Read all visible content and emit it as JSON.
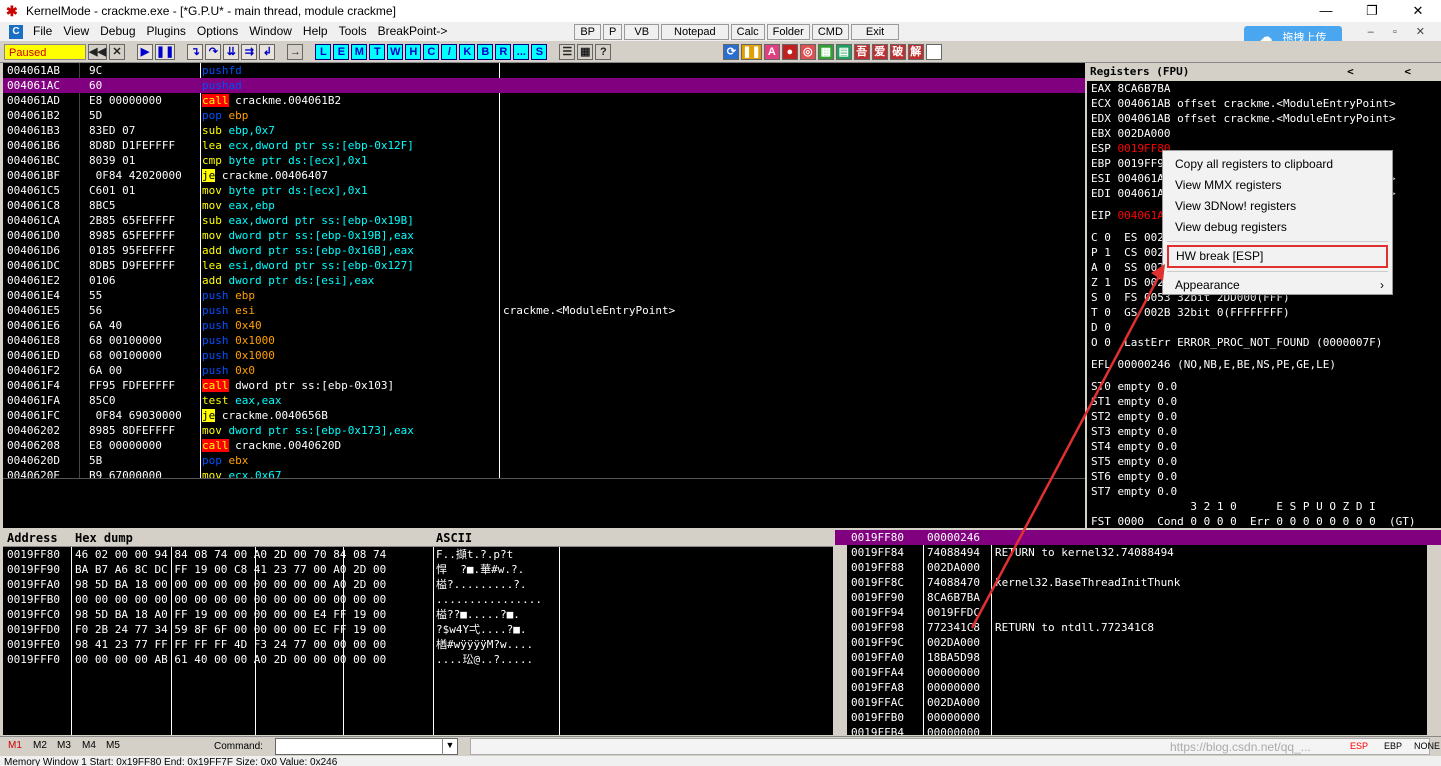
{
  "window": {
    "title": "KernelMode - crackme.exe - [*G.P.U* - main thread, module crackme]",
    "controls": [
      "—",
      "❐",
      "✕"
    ]
  },
  "menu": {
    "items": [
      "File",
      "View",
      "Debug",
      "Plugins",
      "Options",
      "Window",
      "Help",
      "Tools",
      "BreakPoint->"
    ],
    "tool_buttons": [
      "BP",
      "P",
      "VB",
      "Notepad",
      "Calc",
      "Folder",
      "CMD",
      "Exit"
    ],
    "mdi_controls": "– ▫ ✕"
  },
  "cloud_button": {
    "label": "拖拽上传"
  },
  "toolbar": {
    "status": "Paused",
    "letter_buttons": [
      "L",
      "E",
      "M",
      "T",
      "W",
      "H",
      "C",
      "/",
      "K",
      "B",
      "R",
      "...",
      "S"
    ]
  },
  "cpu": {
    "rows": [
      {
        "addr": "004061AB",
        "hex": "9C",
        "mn": "pushfd",
        "ops": "",
        "cls": "k-push",
        "sel": false
      },
      {
        "addr": "004061AC",
        "hex": "60",
        "mn": "pushad",
        "ops": "",
        "cls": "k-push",
        "sel": true
      },
      {
        "addr": "004061AD",
        "hex": "E8 00000000",
        "mn": "call",
        "ops": " crackme.004061B2",
        "cls": "k-call",
        "sel": false
      },
      {
        "addr": "004061B2",
        "hex": "5D",
        "mn": "pop",
        "ops": " ebp",
        "cls": "k-pop",
        "sel": false
      },
      {
        "addr": "004061B3",
        "hex": "83ED 07",
        "mn": "sub",
        "ops": " ebp,0x7",
        "cls": "k-nrm",
        "sel": false
      },
      {
        "addr": "004061B6",
        "hex": "8D8D D1FEFFFF",
        "mn": "lea",
        "ops": " ecx,dword ptr ss:[ebp-0x12F]",
        "cls": "k-nrm",
        "sel": false
      },
      {
        "addr": "004061BC",
        "hex": "8039 01",
        "mn": "cmp",
        "ops": " byte ptr ds:[ecx],0x1",
        "cls": "k-nrm",
        "sel": false
      },
      {
        "addr": "004061BF",
        "hex": " 0F84 42020000",
        "mn": "je",
        "ops": " crackme.00406407",
        "cls": "k-je",
        "sel": false
      },
      {
        "addr": "004061C5",
        "hex": "C601 01",
        "mn": "mov",
        "ops": " byte ptr ds:[ecx],0x1",
        "cls": "k-nrm",
        "sel": false
      },
      {
        "addr": "004061C8",
        "hex": "8BC5",
        "mn": "mov",
        "ops": " eax,ebp",
        "cls": "k-nrm",
        "sel": false
      },
      {
        "addr": "004061CA",
        "hex": "2B85 65FEFFFF",
        "mn": "sub",
        "ops": " eax,dword ptr ss:[ebp-0x19B]",
        "cls": "k-nrm",
        "sel": false
      },
      {
        "addr": "004061D0",
        "hex": "8985 65FEFFFF",
        "mn": "mov",
        "ops": " dword ptr ss:[ebp-0x19B],eax",
        "cls": "k-nrm",
        "sel": false
      },
      {
        "addr": "004061D6",
        "hex": "0185 95FEFFFF",
        "mn": "add",
        "ops": " dword ptr ss:[ebp-0x16B],eax",
        "cls": "k-nrm",
        "sel": false
      },
      {
        "addr": "004061DC",
        "hex": "8DB5 D9FEFFFF",
        "mn": "lea",
        "ops": " esi,dword ptr ss:[ebp-0x127]",
        "cls": "k-nrm",
        "sel": false
      },
      {
        "addr": "004061E2",
        "hex": "0106",
        "mn": "add",
        "ops": " dword ptr ds:[esi],eax",
        "cls": "k-nrm",
        "sel": false
      },
      {
        "addr": "004061E4",
        "hex": "55",
        "mn": "push",
        "ops": " ebp",
        "cls": "k-push",
        "sel": false
      },
      {
        "addr": "004061E5",
        "hex": "56",
        "mn": "push",
        "ops": " esi",
        "cls": "k-push",
        "sel": false
      },
      {
        "addr": "004061E6",
        "hex": "6A 40",
        "mn": "push",
        "ops": " 0x40",
        "cls": "k-push",
        "sel": false
      },
      {
        "addr": "004061E8",
        "hex": "68 00100000",
        "mn": "push",
        "ops": " 0x1000",
        "cls": "k-push",
        "sel": false
      },
      {
        "addr": "004061ED",
        "hex": "68 00100000",
        "mn": "push",
        "ops": " 0x1000",
        "cls": "k-push",
        "sel": false
      },
      {
        "addr": "004061F2",
        "hex": "6A 00",
        "mn": "push",
        "ops": " 0x0",
        "cls": "k-push",
        "sel": false
      },
      {
        "addr": "004061F4",
        "hex": "FF95 FDFEFFFF",
        "mn": "call",
        "ops": " dword ptr ss:[ebp-0x103]",
        "cls": "k-call",
        "sel": false
      },
      {
        "addr": "004061FA",
        "hex": "85C0",
        "mn": "test",
        "ops": " eax,eax",
        "cls": "k-nrm",
        "sel": false
      },
      {
        "addr": "004061FC",
        "hex": " 0F84 69030000",
        "mn": "je",
        "ops": " crackme.0040656B",
        "cls": "k-je",
        "sel": false
      },
      {
        "addr": "00406202",
        "hex": "8985 8DFEFFFF",
        "mn": "mov",
        "ops": " dword ptr ss:[ebp-0x173],eax",
        "cls": "k-nrm",
        "sel": false
      },
      {
        "addr": "00406208",
        "hex": "E8 00000000",
        "mn": "call",
        "ops": " crackme.0040620D",
        "cls": "k-call",
        "sel": false
      },
      {
        "addr": "0040620D",
        "hex": "5B",
        "mn": "pop",
        "ops": " ebx",
        "cls": "k-pop",
        "sel": false
      },
      {
        "addr": "0040620E",
        "hex": "B9 67000000",
        "mn": "mov",
        "ops": " ecx,0x67",
        "cls": "k-nrm",
        "sel": false
      }
    ],
    "comment_row": 16,
    "comment": "crackme.<ModuleEntryPoint>"
  },
  "registers": {
    "header": "Registers (FPU)",
    "arrows": "< <",
    "lines": [
      {
        "t": "EAX 8CA6B7BA",
        "red": false
      },
      {
        "t": "ECX 004061AB offset crackme.<ModuleEntryPoint>",
        "red": false
      },
      {
        "t": "EDX 004061AB offset crackme.<ModuleEntryPoint>",
        "red": false
      },
      {
        "t": "EBX 002DA000",
        "red": false
      },
      {
        "t": "ESP 0019FF80",
        "red": true
      },
      {
        "t": "EBP 0019FF94",
        "red": false
      },
      {
        "t": "ESI 004061AB offset crackme.<ModuleEntryPoint>",
        "red": false
      },
      {
        "t": "EDI 004061AB offset crackme.<ModuleEntryPoint>",
        "red": false
      },
      {
        "t": "",
        "red": false,
        "gap": true
      },
      {
        "t": "EIP 004061AC crackme.004061AC",
        "red": true
      },
      {
        "t": "",
        "red": false,
        "gap": true
      },
      {
        "t": "C 0  ES 002B 32bit 0(FFFFFFFF)",
        "red": false
      },
      {
        "t": "P 1  CS 0023 32bit 0(FFFFFFFF)",
        "red": false
      },
      {
        "t": "A 0  SS 002B 32bit 0(FFFFFFFF)",
        "red": false
      },
      {
        "t": "Z 1  DS 002B 32bit 0(FFFFFFFF)",
        "red": false
      },
      {
        "t": "S 0  FS 0053 32bit 2DD000(FFF)",
        "red": false
      },
      {
        "t": "T 0  GS 002B 32bit 0(FFFFFFFF)",
        "red": false
      },
      {
        "t": "D 0",
        "red": false
      },
      {
        "t": "O 0  LastErr ERROR_PROC_NOT_FOUND (0000007F)",
        "red": false
      },
      {
        "t": "",
        "red": false,
        "gap": true
      },
      {
        "t": "EFL 00000246 (NO,NB,E,BE,NS,PE,GE,LE)",
        "red": false
      },
      {
        "t": "",
        "red": false,
        "gap": true
      },
      {
        "t": "ST0 empty 0.0",
        "red": false
      },
      {
        "t": "ST1 empty 0.0",
        "red": false
      },
      {
        "t": "ST2 empty 0.0",
        "red": false
      },
      {
        "t": "ST3 empty 0.0",
        "red": false
      },
      {
        "t": "ST4 empty 0.0",
        "red": false
      },
      {
        "t": "ST5 empty 0.0",
        "red": false
      },
      {
        "t": "ST6 empty 0.0",
        "red": false
      },
      {
        "t": "ST7 empty 0.0",
        "red": false
      },
      {
        "t": "               3 2 1 0      E S P U O Z D I",
        "red": false
      },
      {
        "t": "FST 0000  Cond 0 0 0 0  Err 0 0 0 0 0 0 0 0  (GT)",
        "red": false
      }
    ]
  },
  "dump": {
    "headers": {
      "address": "Address",
      "hex": "Hex dump",
      "ascii": "ASCII"
    },
    "rows": [
      {
        "addr": "0019FF80",
        "hex": "46 02 00 00 94 84 08 74 00 A0 2D 00 70 84 08 74",
        "ascii": "F..擷t.?.p?t"
      },
      {
        "addr": "0019FF90",
        "hex": "BA B7 A6 8C DC FF 19 00 C8 41 23 77 00 A0 2D 00",
        "ascii": "悍  ?■.華#w.?."
      },
      {
        "addr": "0019FFA0",
        "hex": "98 5D BA 18 00 00 00 00 00 00 00 00 00 A0 2D 00",
        "ascii": "榏?.........?."
      },
      {
        "addr": "0019FFB0",
        "hex": "00 00 00 00 00 00 00 00 00 00 00 00 00 00 00 00",
        "ascii": "................"
      },
      {
        "addr": "0019FFC0",
        "hex": "98 5D BA 18 A0 FF 19 00 00 00 00 00 E4 FF 19 00",
        "ascii": "榏??■.....?■."
      },
      {
        "addr": "0019FFD0",
        "hex": "F0 2B 24 77 34 59 8F 6F 00 00 00 00 EC FF 19 00",
        "ascii": "?$w4Y弌....?■."
      },
      {
        "addr": "0019FFE0",
        "hex": "98 41 23 77 FF FF FF FF 4D F3 24 77 00 00 00 00",
        "ascii": "楢#wÿÿÿÿM?w...."
      },
      {
        "addr": "0019FFF0",
        "hex": "00 00 00 00 AB 61 40 00 00 A0 2D 00 00 00 00 00",
        "ascii": "....玜@..?....."
      }
    ]
  },
  "stack": {
    "rows": [
      {
        "addr": "0019FF80",
        "val": "00000246",
        "cmt": "",
        "sel": true
      },
      {
        "addr": "0019FF84",
        "val": "74088494",
        "cmt": "RETURN to kernel32.74088494",
        "sel": false
      },
      {
        "addr": "0019FF88",
        "val": "002DA000",
        "cmt": "",
        "sel": false
      },
      {
        "addr": "0019FF8C",
        "val": "74088470",
        "cmt": "kernel32.BaseThreadInitThunk",
        "sel": false
      },
      {
        "addr": "0019FF90",
        "val": "8CA6B7BA",
        "cmt": "",
        "sel": false
      },
      {
        "addr": "0019FF94",
        "val": "0019FFDC",
        "cmt": "",
        "sel": false
      },
      {
        "addr": "0019FF98",
        "val": "772341C8",
        "cmt": "RETURN to ntdll.772341C8",
        "sel": false
      },
      {
        "addr": "0019FF9C",
        "val": "002DA000",
        "cmt": "",
        "sel": false
      },
      {
        "addr": "0019FFA0",
        "val": "18BA5D98",
        "cmt": "",
        "sel": false
      },
      {
        "addr": "0019FFA4",
        "val": "00000000",
        "cmt": "",
        "sel": false
      },
      {
        "addr": "0019FFA8",
        "val": "00000000",
        "cmt": "",
        "sel": false
      },
      {
        "addr": "0019FFAC",
        "val": "002DA000",
        "cmt": "",
        "sel": false
      },
      {
        "addr": "0019FFB0",
        "val": "00000000",
        "cmt": "",
        "sel": false
      },
      {
        "addr": "0019FFB4",
        "val": "00000000",
        "cmt": "",
        "sel": false
      }
    ]
  },
  "cmdbar": {
    "marks": [
      "M1",
      "M2",
      "M3",
      "M4",
      "M5"
    ],
    "command_label": "Command:",
    "command_value": "",
    "right": {
      "esp": "ESP",
      "ebp": "EBP",
      "none": "NONE"
    },
    "watermark": "https://blog.csdn.net/qq_..."
  },
  "statusbar": {
    "text": "Memory Window 1  Start: 0x19FF80  End: 0x19FF7F  Size: 0x0 Value: 0x246"
  },
  "context_menu": {
    "items": [
      "Copy all registers to clipboard",
      "View MMX registers",
      "View 3DNow! registers",
      "View debug registers"
    ],
    "hw_break": "HW break [ESP]",
    "appearance": "Appearance",
    "submenu_arrow": "›"
  },
  "colors": {
    "selection": "#800080",
    "annotation": "#e03030",
    "pane_bg": "#000000"
  }
}
